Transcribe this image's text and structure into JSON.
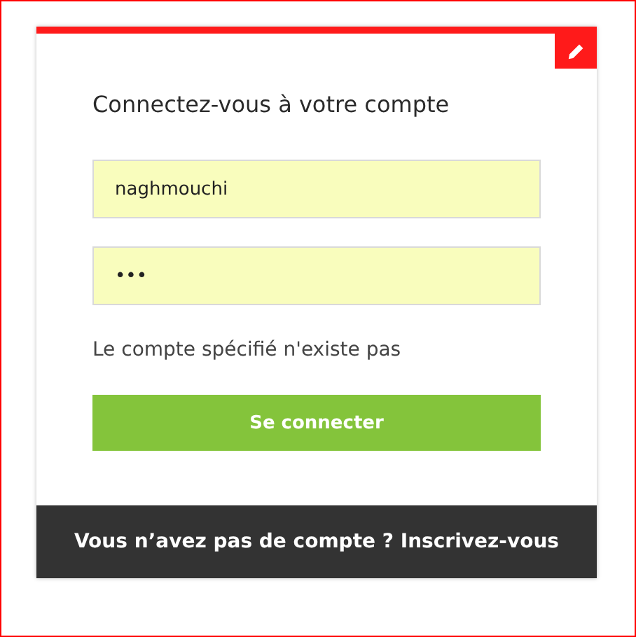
{
  "card": {
    "title": "Connectez-vous à votre compte",
    "username_field": {
      "value": "naghmouchi"
    },
    "password_field": {
      "value": "•••"
    },
    "error_message": "Le compte spécifié n'existe pas",
    "submit_button": {
      "label": "Se connecter"
    },
    "footer_link": "Vous n’avez pas de compte ? Inscrivez-vous"
  }
}
